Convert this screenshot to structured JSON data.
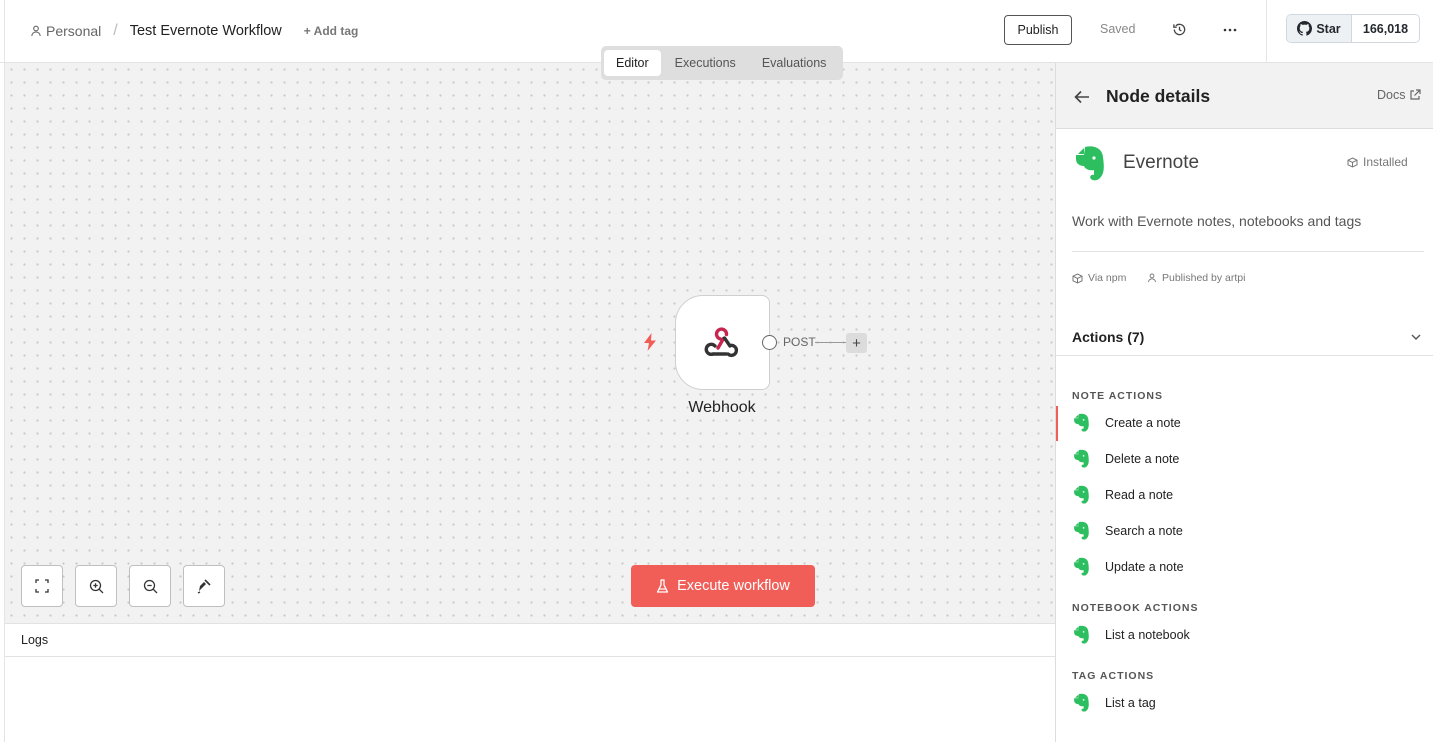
{
  "header": {
    "project": "Personal",
    "separator": "/",
    "workflow_name": "Test Evernote Workflow",
    "add_tag": "+ Add tag",
    "publish": "Publish",
    "saved": "Saved",
    "github": {
      "star": "Star",
      "count": "166,018"
    }
  },
  "tabs": [
    {
      "label": "Editor",
      "active": true
    },
    {
      "label": "Executions",
      "active": false
    },
    {
      "label": "Evaluations",
      "active": false
    }
  ],
  "canvas": {
    "node": {
      "label": "Webhook",
      "output_label": "POST",
      "icon": "webhook-icon"
    },
    "execute_button": "Execute workflow",
    "controls": [
      "fit-view-icon",
      "zoom-in-icon",
      "zoom-out-icon",
      "tidy-up-icon"
    ]
  },
  "logs": {
    "title": "Logs"
  },
  "panel": {
    "title": "Node details",
    "docs": "Docs",
    "node_name": "Evernote",
    "status": "Installed",
    "description": "Work with Evernote notes, notebooks and tags",
    "via": "Via npm",
    "publisher": "Published by artpi",
    "actions_header": "Actions (7)",
    "sections": [
      {
        "title": "NOTE ACTIONS",
        "items": [
          "Create a note",
          "Delete a note",
          "Read a note",
          "Search a note",
          "Update a note"
        ]
      },
      {
        "title": "NOTEBOOK ACTIONS",
        "items": [
          "List a notebook"
        ]
      },
      {
        "title": "TAG ACTIONS",
        "items": [
          "List a tag"
        ]
      }
    ]
  },
  "colors": {
    "accent": "#f15e58",
    "evernote_green": "#2dbe60",
    "webhook_red": "#c7254e"
  }
}
